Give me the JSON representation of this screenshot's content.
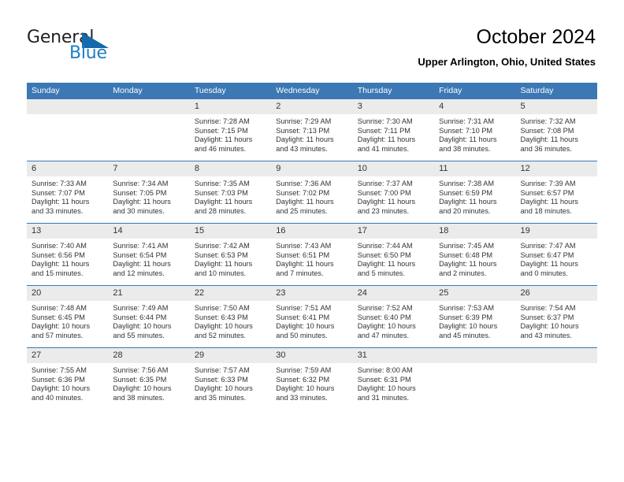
{
  "brand": {
    "name_top": "General",
    "name_bottom": "Blue",
    "accent_color": "#1c7fc4",
    "triangle_color": "#1569ac"
  },
  "header": {
    "title": "October 2024",
    "subtitle": "Upper Arlington, Ohio, United States"
  },
  "calendar": {
    "header_bg": "#3b78b4",
    "daynum_bg": "#ebebeb",
    "weekdays": [
      "Sunday",
      "Monday",
      "Tuesday",
      "Wednesday",
      "Thursday",
      "Friday",
      "Saturday"
    ],
    "weeks": [
      [
        {
          "day": "",
          "empty": true,
          "sunrise": "",
          "sunset": "",
          "daylight1": "",
          "daylight2": ""
        },
        {
          "day": "",
          "empty": true,
          "sunrise": "",
          "sunset": "",
          "daylight1": "",
          "daylight2": ""
        },
        {
          "day": "1",
          "sunrise": "Sunrise: 7:28 AM",
          "sunset": "Sunset: 7:15 PM",
          "daylight1": "Daylight: 11 hours",
          "daylight2": "and 46 minutes."
        },
        {
          "day": "2",
          "sunrise": "Sunrise: 7:29 AM",
          "sunset": "Sunset: 7:13 PM",
          "daylight1": "Daylight: 11 hours",
          "daylight2": "and 43 minutes."
        },
        {
          "day": "3",
          "sunrise": "Sunrise: 7:30 AM",
          "sunset": "Sunset: 7:11 PM",
          "daylight1": "Daylight: 11 hours",
          "daylight2": "and 41 minutes."
        },
        {
          "day": "4",
          "sunrise": "Sunrise: 7:31 AM",
          "sunset": "Sunset: 7:10 PM",
          "daylight1": "Daylight: 11 hours",
          "daylight2": "and 38 minutes."
        },
        {
          "day": "5",
          "sunrise": "Sunrise: 7:32 AM",
          "sunset": "Sunset: 7:08 PM",
          "daylight1": "Daylight: 11 hours",
          "daylight2": "and 36 minutes."
        }
      ],
      [
        {
          "day": "6",
          "sunrise": "Sunrise: 7:33 AM",
          "sunset": "Sunset: 7:07 PM",
          "daylight1": "Daylight: 11 hours",
          "daylight2": "and 33 minutes."
        },
        {
          "day": "7",
          "sunrise": "Sunrise: 7:34 AM",
          "sunset": "Sunset: 7:05 PM",
          "daylight1": "Daylight: 11 hours",
          "daylight2": "and 30 minutes."
        },
        {
          "day": "8",
          "sunrise": "Sunrise: 7:35 AM",
          "sunset": "Sunset: 7:03 PM",
          "daylight1": "Daylight: 11 hours",
          "daylight2": "and 28 minutes."
        },
        {
          "day": "9",
          "sunrise": "Sunrise: 7:36 AM",
          "sunset": "Sunset: 7:02 PM",
          "daylight1": "Daylight: 11 hours",
          "daylight2": "and 25 minutes."
        },
        {
          "day": "10",
          "sunrise": "Sunrise: 7:37 AM",
          "sunset": "Sunset: 7:00 PM",
          "daylight1": "Daylight: 11 hours",
          "daylight2": "and 23 minutes."
        },
        {
          "day": "11",
          "sunrise": "Sunrise: 7:38 AM",
          "sunset": "Sunset: 6:59 PM",
          "daylight1": "Daylight: 11 hours",
          "daylight2": "and 20 minutes."
        },
        {
          "day": "12",
          "sunrise": "Sunrise: 7:39 AM",
          "sunset": "Sunset: 6:57 PM",
          "daylight1": "Daylight: 11 hours",
          "daylight2": "and 18 minutes."
        }
      ],
      [
        {
          "day": "13",
          "sunrise": "Sunrise: 7:40 AM",
          "sunset": "Sunset: 6:56 PM",
          "daylight1": "Daylight: 11 hours",
          "daylight2": "and 15 minutes."
        },
        {
          "day": "14",
          "sunrise": "Sunrise: 7:41 AM",
          "sunset": "Sunset: 6:54 PM",
          "daylight1": "Daylight: 11 hours",
          "daylight2": "and 12 minutes."
        },
        {
          "day": "15",
          "sunrise": "Sunrise: 7:42 AM",
          "sunset": "Sunset: 6:53 PM",
          "daylight1": "Daylight: 11 hours",
          "daylight2": "and 10 minutes."
        },
        {
          "day": "16",
          "sunrise": "Sunrise: 7:43 AM",
          "sunset": "Sunset: 6:51 PM",
          "daylight1": "Daylight: 11 hours",
          "daylight2": "and 7 minutes."
        },
        {
          "day": "17",
          "sunrise": "Sunrise: 7:44 AM",
          "sunset": "Sunset: 6:50 PM",
          "daylight1": "Daylight: 11 hours",
          "daylight2": "and 5 minutes."
        },
        {
          "day": "18",
          "sunrise": "Sunrise: 7:45 AM",
          "sunset": "Sunset: 6:48 PM",
          "daylight1": "Daylight: 11 hours",
          "daylight2": "and 2 minutes."
        },
        {
          "day": "19",
          "sunrise": "Sunrise: 7:47 AM",
          "sunset": "Sunset: 6:47 PM",
          "daylight1": "Daylight: 11 hours",
          "daylight2": "and 0 minutes."
        }
      ],
      [
        {
          "day": "20",
          "sunrise": "Sunrise: 7:48 AM",
          "sunset": "Sunset: 6:45 PM",
          "daylight1": "Daylight: 10 hours",
          "daylight2": "and 57 minutes."
        },
        {
          "day": "21",
          "sunrise": "Sunrise: 7:49 AM",
          "sunset": "Sunset: 6:44 PM",
          "daylight1": "Daylight: 10 hours",
          "daylight2": "and 55 minutes."
        },
        {
          "day": "22",
          "sunrise": "Sunrise: 7:50 AM",
          "sunset": "Sunset: 6:43 PM",
          "daylight1": "Daylight: 10 hours",
          "daylight2": "and 52 minutes."
        },
        {
          "day": "23",
          "sunrise": "Sunrise: 7:51 AM",
          "sunset": "Sunset: 6:41 PM",
          "daylight1": "Daylight: 10 hours",
          "daylight2": "and 50 minutes."
        },
        {
          "day": "24",
          "sunrise": "Sunrise: 7:52 AM",
          "sunset": "Sunset: 6:40 PM",
          "daylight1": "Daylight: 10 hours",
          "daylight2": "and 47 minutes."
        },
        {
          "day": "25",
          "sunrise": "Sunrise: 7:53 AM",
          "sunset": "Sunset: 6:39 PM",
          "daylight1": "Daylight: 10 hours",
          "daylight2": "and 45 minutes."
        },
        {
          "day": "26",
          "sunrise": "Sunrise: 7:54 AM",
          "sunset": "Sunset: 6:37 PM",
          "daylight1": "Daylight: 10 hours",
          "daylight2": "and 43 minutes."
        }
      ],
      [
        {
          "day": "27",
          "sunrise": "Sunrise: 7:55 AM",
          "sunset": "Sunset: 6:36 PM",
          "daylight1": "Daylight: 10 hours",
          "daylight2": "and 40 minutes."
        },
        {
          "day": "28",
          "sunrise": "Sunrise: 7:56 AM",
          "sunset": "Sunset: 6:35 PM",
          "daylight1": "Daylight: 10 hours",
          "daylight2": "and 38 minutes."
        },
        {
          "day": "29",
          "sunrise": "Sunrise: 7:57 AM",
          "sunset": "Sunset: 6:33 PM",
          "daylight1": "Daylight: 10 hours",
          "daylight2": "and 35 minutes."
        },
        {
          "day": "30",
          "sunrise": "Sunrise: 7:59 AM",
          "sunset": "Sunset: 6:32 PM",
          "daylight1": "Daylight: 10 hours",
          "daylight2": "and 33 minutes."
        },
        {
          "day": "31",
          "sunrise": "Sunrise: 8:00 AM",
          "sunset": "Sunset: 6:31 PM",
          "daylight1": "Daylight: 10 hours",
          "daylight2": "and 31 minutes."
        },
        {
          "day": "",
          "empty": true,
          "sunrise": "",
          "sunset": "",
          "daylight1": "",
          "daylight2": ""
        },
        {
          "day": "",
          "empty": true,
          "sunrise": "",
          "sunset": "",
          "daylight1": "",
          "daylight2": ""
        }
      ]
    ]
  }
}
